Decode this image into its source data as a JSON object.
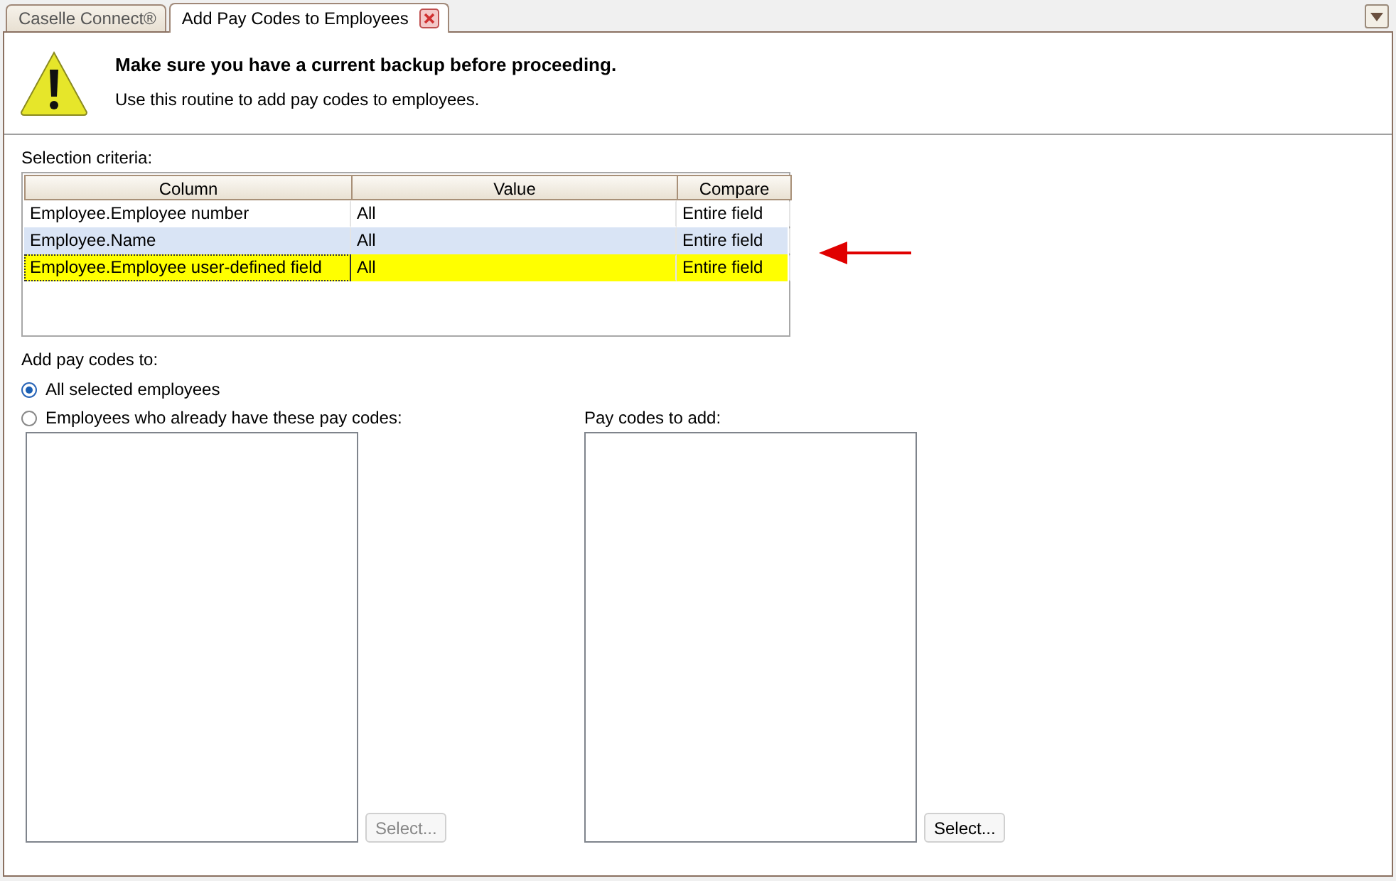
{
  "tabs": [
    {
      "label": "Caselle Connect®",
      "selected": false,
      "closable": false
    },
    {
      "label": "Add Pay Codes to Employees",
      "selected": true,
      "closable": true
    }
  ],
  "header": {
    "title": "Make sure you have a current backup before proceeding.",
    "description": "Use this routine to add pay codes to employees."
  },
  "selection_criteria": {
    "label": "Selection criteria:",
    "columns": [
      "Column",
      "Value",
      "Compare"
    ],
    "rows": [
      {
        "cells": [
          "Employee.Employee number",
          "All",
          "Entire field"
        ],
        "selected": false,
        "hovered": false
      },
      {
        "cells": [
          "Employee.Name",
          "All",
          "Entire field"
        ],
        "selected": false,
        "hovered": true
      },
      {
        "cells": [
          "Employee.Employee user-defined field",
          "All",
          "Entire field"
        ],
        "selected": true,
        "hovered": false
      }
    ]
  },
  "add_to": {
    "label": "Add pay codes to:",
    "options": [
      {
        "label": "All selected employees",
        "selected": true
      },
      {
        "label": "Employees who already have these pay codes:",
        "selected": false
      }
    ]
  },
  "left_list": {
    "button": {
      "label": "Select...",
      "disabled": true
    }
  },
  "pay_codes": {
    "label": "Pay codes to add:",
    "button": {
      "label": "Select...",
      "disabled": false
    }
  }
}
